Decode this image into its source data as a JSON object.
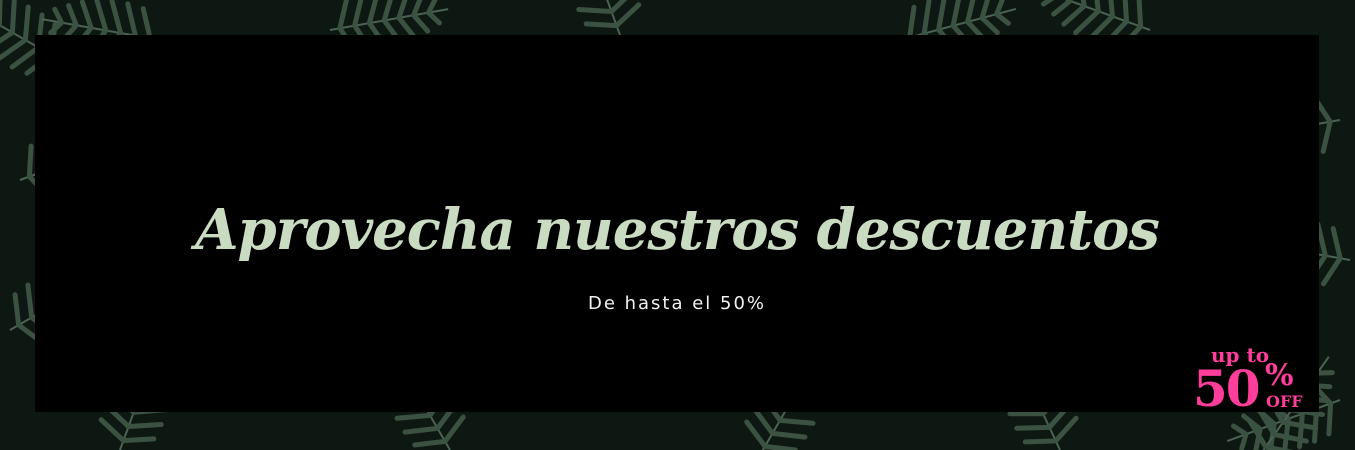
{
  "banner": {
    "headline": "Aprovecha nuestros descuentos",
    "subheadline": "De hasta el 50%",
    "badge": {
      "top_text": "up to",
      "number": "50",
      "percent": "%",
      "bottom_text": "OFF"
    }
  },
  "colors": {
    "headline": "#c9dcc2",
    "subheadline": "#f2f2f2",
    "badge": "#ff3d9a",
    "panel": "#000000",
    "fern": "#3e5446"
  },
  "background_image": "fern-leaves-icon"
}
